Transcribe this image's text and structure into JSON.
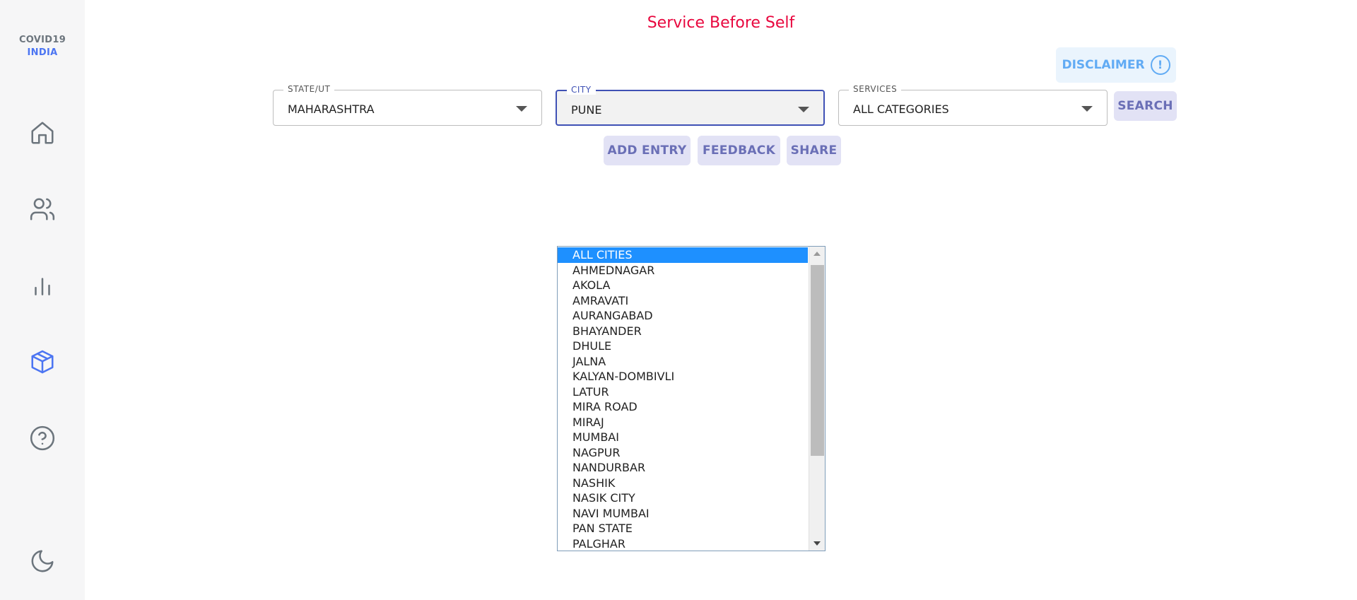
{
  "sidebar": {
    "logo_line1": "COVID19",
    "logo_line2": "INDIA",
    "items": [
      {
        "name": "home"
      },
      {
        "name": "users"
      },
      {
        "name": "chart"
      },
      {
        "name": "resources",
        "active": true
      },
      {
        "name": "help"
      },
      {
        "name": "dark-mode"
      }
    ]
  },
  "header": {
    "tagline": "Service Before Self"
  },
  "disclaimer": {
    "label": "DISCLAIMER",
    "icon_glyph": "!"
  },
  "filters": {
    "state": {
      "label": "STATE/UT",
      "value": "MAHARASHTRA"
    },
    "city": {
      "label": "CITY",
      "value": "PUNE"
    },
    "services": {
      "label": "SERVICES",
      "value": "ALL CATEGORIES"
    }
  },
  "buttons": {
    "search": "SEARCH",
    "add_entry": "ADD ENTRY",
    "feedback": "FEEDBACK",
    "share": "SHARE"
  },
  "city_dropdown": {
    "selected": "ALL CITIES",
    "options": [
      "ALL CITIES",
      "AHMEDNAGAR",
      "AKOLA",
      "AMRAVATI",
      "AURANGABAD",
      "BHAYANDER",
      "DHULE",
      "JALNA",
      "KALYAN-DOMBIVLI",
      "LATUR",
      "MIRA ROAD",
      "MIRAJ",
      "MUMBAI",
      "NAGPUR",
      "NANDURBAR",
      "NASHIK",
      "NASIK CITY",
      "NAVI MUMBAI",
      "PAN STATE",
      "PALGHAR"
    ]
  },
  "colors": {
    "accent": "#4c75f2",
    "tagline": "#e8073e",
    "button_bg": "#e2e2f5",
    "button_text": "#6a6fb6",
    "selected_option": "#1e90ff"
  }
}
